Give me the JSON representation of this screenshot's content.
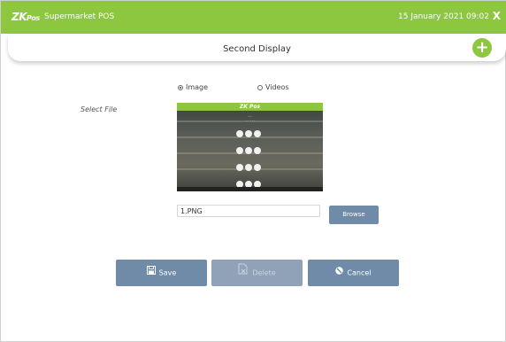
{
  "topbar": {
    "logo_main": "ZK",
    "logo_sub": "Pos",
    "app_title": "Supermarket POS",
    "datetime": "15 January 2021 09:02",
    "close_label": "X",
    "color": "#8dc63f"
  },
  "header": {
    "title": "Second Display",
    "add_label": "+"
  },
  "media_type": {
    "options": [
      {
        "label": "Image",
        "selected": true
      },
      {
        "label": "Videos",
        "selected": false
      }
    ]
  },
  "file": {
    "label": "Select File",
    "value": "1.PNG",
    "browse_label": "Browse",
    "preview_icon": "supermarket-display-thumbnail"
  },
  "actions": {
    "save_label": "Save",
    "delete_label": "Delete",
    "cancel_label": "Cancel",
    "delete_enabled": false,
    "button_color": "#6f8ba7"
  }
}
